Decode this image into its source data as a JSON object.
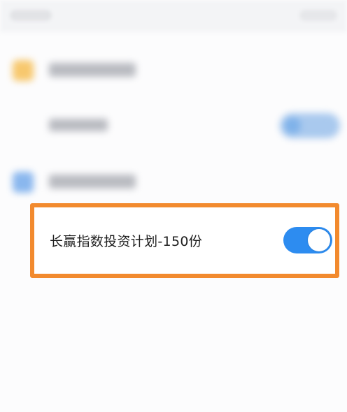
{
  "plan_row": {
    "label": "长赢指数投资计划-150份",
    "toggle_on": true
  },
  "colors": {
    "highlight_border": "#f28a2e",
    "toggle_on": "#2d8cf0",
    "group_icon_1": "#f7c86e",
    "group_icon_2": "#8ab7ee"
  }
}
